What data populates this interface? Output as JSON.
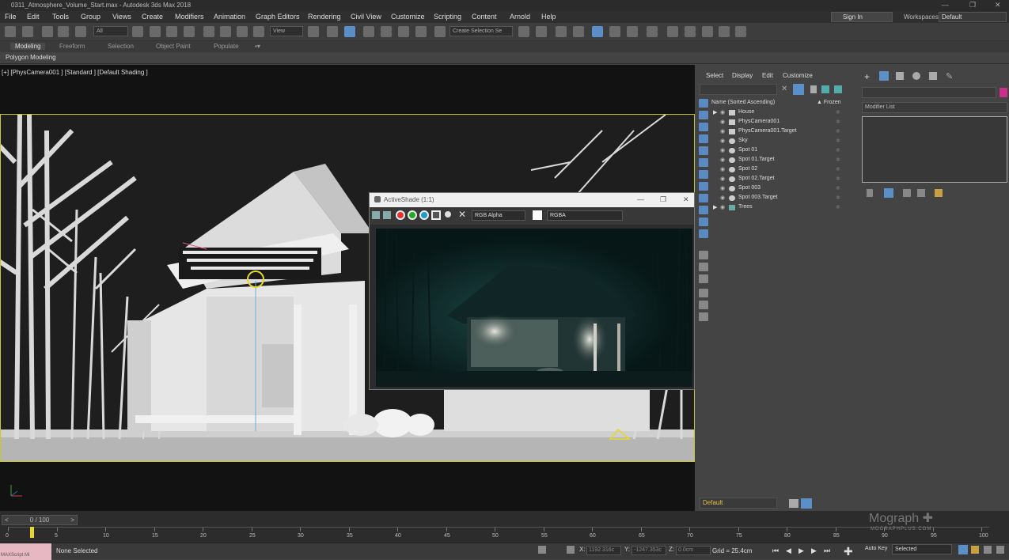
{
  "window": {
    "title": "0311_Atmosphere_Volume_Start.max - Autodesk 3ds Max 2018",
    "minimize": "—",
    "restore": "❐",
    "close": "✕"
  },
  "menu": [
    "File",
    "Edit",
    "Tools",
    "Group",
    "Views",
    "Create",
    "Modifiers",
    "Animation",
    "Graph Editors",
    "Rendering",
    "Civil View",
    "Customize",
    "Scripting",
    "Content",
    "Arnold",
    "Help"
  ],
  "account": {
    "signin": "Sign In",
    "workspaces_label": "Workspaces:",
    "workspace_value": "Default"
  },
  "toolbar": {
    "selection_filter": "All",
    "ref_coord": "View",
    "named_selection": "Create Selection Se"
  },
  "ribbon": {
    "tabs": [
      "Modeling",
      "Freeform",
      "Selection",
      "Object Paint",
      "Populate"
    ],
    "active_tab": "Modeling",
    "sub_panel": "Polygon Modeling"
  },
  "viewport": {
    "label": "[+] [PhysCamera001 ] [Standard ] [Default Shading ]"
  },
  "activeshade": {
    "title": "ActiveShade (1:1)",
    "channel_display": "RGB Alpha",
    "channel_mode": "RGBA"
  },
  "scene_explorer": {
    "menu": [
      "Select",
      "Display",
      "Edit",
      "Customize"
    ],
    "column_name": "Name (Sorted Ascending)",
    "column_frozen": "▲ Frozen",
    "items": [
      {
        "name": "House",
        "expandable": true
      },
      {
        "name": "PhysCamera001",
        "expandable": false
      },
      {
        "name": "PhysCamera001.Target",
        "expandable": false
      },
      {
        "name": "Sky",
        "expandable": false
      },
      {
        "name": "Spot 01",
        "expandable": false
      },
      {
        "name": "Spot 01.Target",
        "expandable": false
      },
      {
        "name": "Spot 02",
        "expandable": false
      },
      {
        "name": "Spot 02.Target",
        "expandable": false
      },
      {
        "name": "Spot 003",
        "expandable": false
      },
      {
        "name": "Spot 003.Target",
        "expandable": false
      },
      {
        "name": "Trees",
        "expandable": true
      }
    ],
    "layer": "Default"
  },
  "command_panel": {
    "modifier_list": "Modifier List",
    "object_color": "#cc2f8a"
  },
  "timeline": {
    "frame_display": "0 / 100",
    "ticks": [
      0,
      5,
      10,
      15,
      20,
      25,
      30,
      35,
      40,
      45,
      50,
      55,
      60,
      65,
      70,
      75,
      80,
      85,
      90,
      95,
      100
    ]
  },
  "status": {
    "message": "None Selected",
    "x_label": "X:",
    "x_value": "1192.316c",
    "y_label": "Y:",
    "y_value": "-1247.353c",
    "z_label": "Z:",
    "z_value": "0.0cm",
    "grid": "Grid = 25.4cm",
    "autokey": "Auto Key",
    "selection_set": "Selected",
    "maxscript": "MAXScript Mi"
  },
  "watermark": {
    "brand": "Mograph",
    "sub": "MOGRAPHPLUS.COM"
  }
}
